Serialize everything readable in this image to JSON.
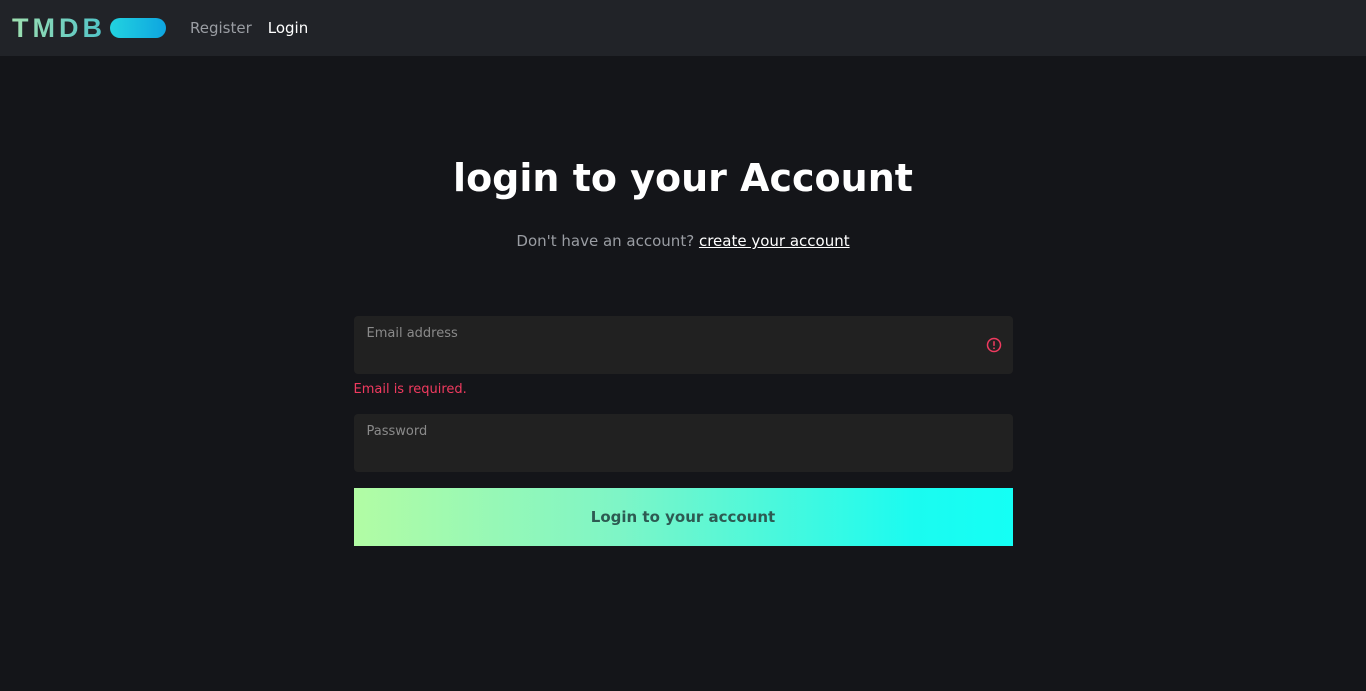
{
  "nav": {
    "brand": "TMDB",
    "links": [
      {
        "label": "Register"
      },
      {
        "label": "Login"
      }
    ]
  },
  "main": {
    "title": "login to your Account",
    "subtitle_text": "Don't have an account?",
    "subtitle_link": "create your account"
  },
  "form": {
    "email": {
      "label": "Email address",
      "value": "",
      "error": "Email is required."
    },
    "password": {
      "label": "Password",
      "value": ""
    },
    "submit_label": "Login to your account"
  },
  "colors": {
    "background": "#141519",
    "navbar": "#212328",
    "field": "#212121",
    "error": "#f03a5f",
    "accent_start": "#b2fca4",
    "accent_end": "#14fff5"
  },
  "icons": {
    "email_error": "alert-circle-icon"
  }
}
